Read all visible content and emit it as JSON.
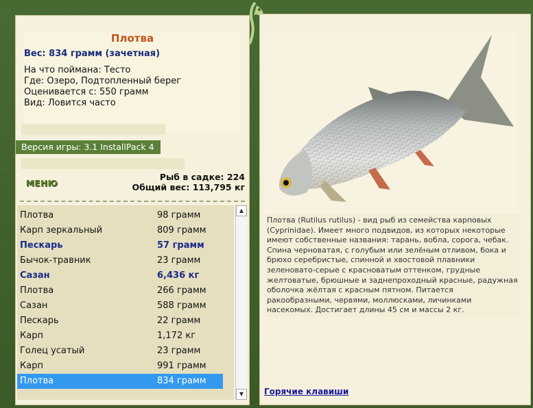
{
  "fish": {
    "name": "Плотва",
    "weight_line": "Вес: 834 грамм (зачетная)",
    "bait_line": "На что поймана: Тесто",
    "place_line": "Где: Озеро, Подтопленный берег",
    "value_line": "Оценивается с: 550 грамм",
    "species_line": "Вид: Ловится часто"
  },
  "version": "Версия игры: 3.1 InstallPack 4",
  "menu_label": "МЕНЮ",
  "stats": {
    "in_keepnet": "Рыб в садке: 224",
    "total_weight": "Общий вес: 113,795 кг"
  },
  "catch_list": [
    {
      "name": "Плотва",
      "weight": "98 грамм",
      "bold": false,
      "selected": false
    },
    {
      "name": "Карп зеркальный",
      "weight": "809 грамм",
      "bold": false,
      "selected": false
    },
    {
      "name": "Пескарь",
      "weight": "57 грамм",
      "bold": true,
      "selected": false
    },
    {
      "name": "Бычок-травник",
      "weight": "23 грамм",
      "bold": false,
      "selected": false
    },
    {
      "name": "Сазан",
      "weight": "6,436 кг",
      "bold": true,
      "selected": false
    },
    {
      "name": "Плотва",
      "weight": "266 грамм",
      "bold": false,
      "selected": false
    },
    {
      "name": "Сазан",
      "weight": "588 грамм",
      "bold": false,
      "selected": false
    },
    {
      "name": "Пескарь",
      "weight": "22 грамм",
      "bold": false,
      "selected": false
    },
    {
      "name": "Карп",
      "weight": "1,172 кг",
      "bold": false,
      "selected": false
    },
    {
      "name": "Голец усатый",
      "weight": "23 грамм",
      "bold": false,
      "selected": false
    },
    {
      "name": "Карп",
      "weight": "991 грамм",
      "bold": false,
      "selected": false
    },
    {
      "name": "Плотва",
      "weight": "834 грамм",
      "bold": false,
      "selected": true
    }
  ],
  "description": "Плотва (Rutilus rutilus) - вид рыб из семейства карповых (Cyprinidae). Имеет много подвидов, из которых некоторые имеют собственные названия: тарань, вобла, сорога, чебак. Спина черноватая, с голубым или зелёным отливом, бока и брюхо серебристые, спинной и хвостовой плавники зеленовато-серые с красноватым оттенком, грудные желтоватые, брюшные и заднепроходный красные, радужная оболочка жёлтая с красным пятном. Питается ракообразными, червями, моллюсками, личинками насекомых. Достигает длины 45 см и массы 2 кг.",
  "hotkeys_label": "Горячие клавиши",
  "icons": {
    "logo": "fish-logo-icon",
    "scroll_up": "triangle-up-icon",
    "scroll_down": "triangle-down-icon"
  },
  "colors": {
    "frame": "#3f5f2a",
    "panel": "#f5f1dc",
    "title": "#c0541c",
    "bold_row": "#1a2a8a",
    "selected_row": "#3399ee",
    "link": "#1a1aa0"
  }
}
